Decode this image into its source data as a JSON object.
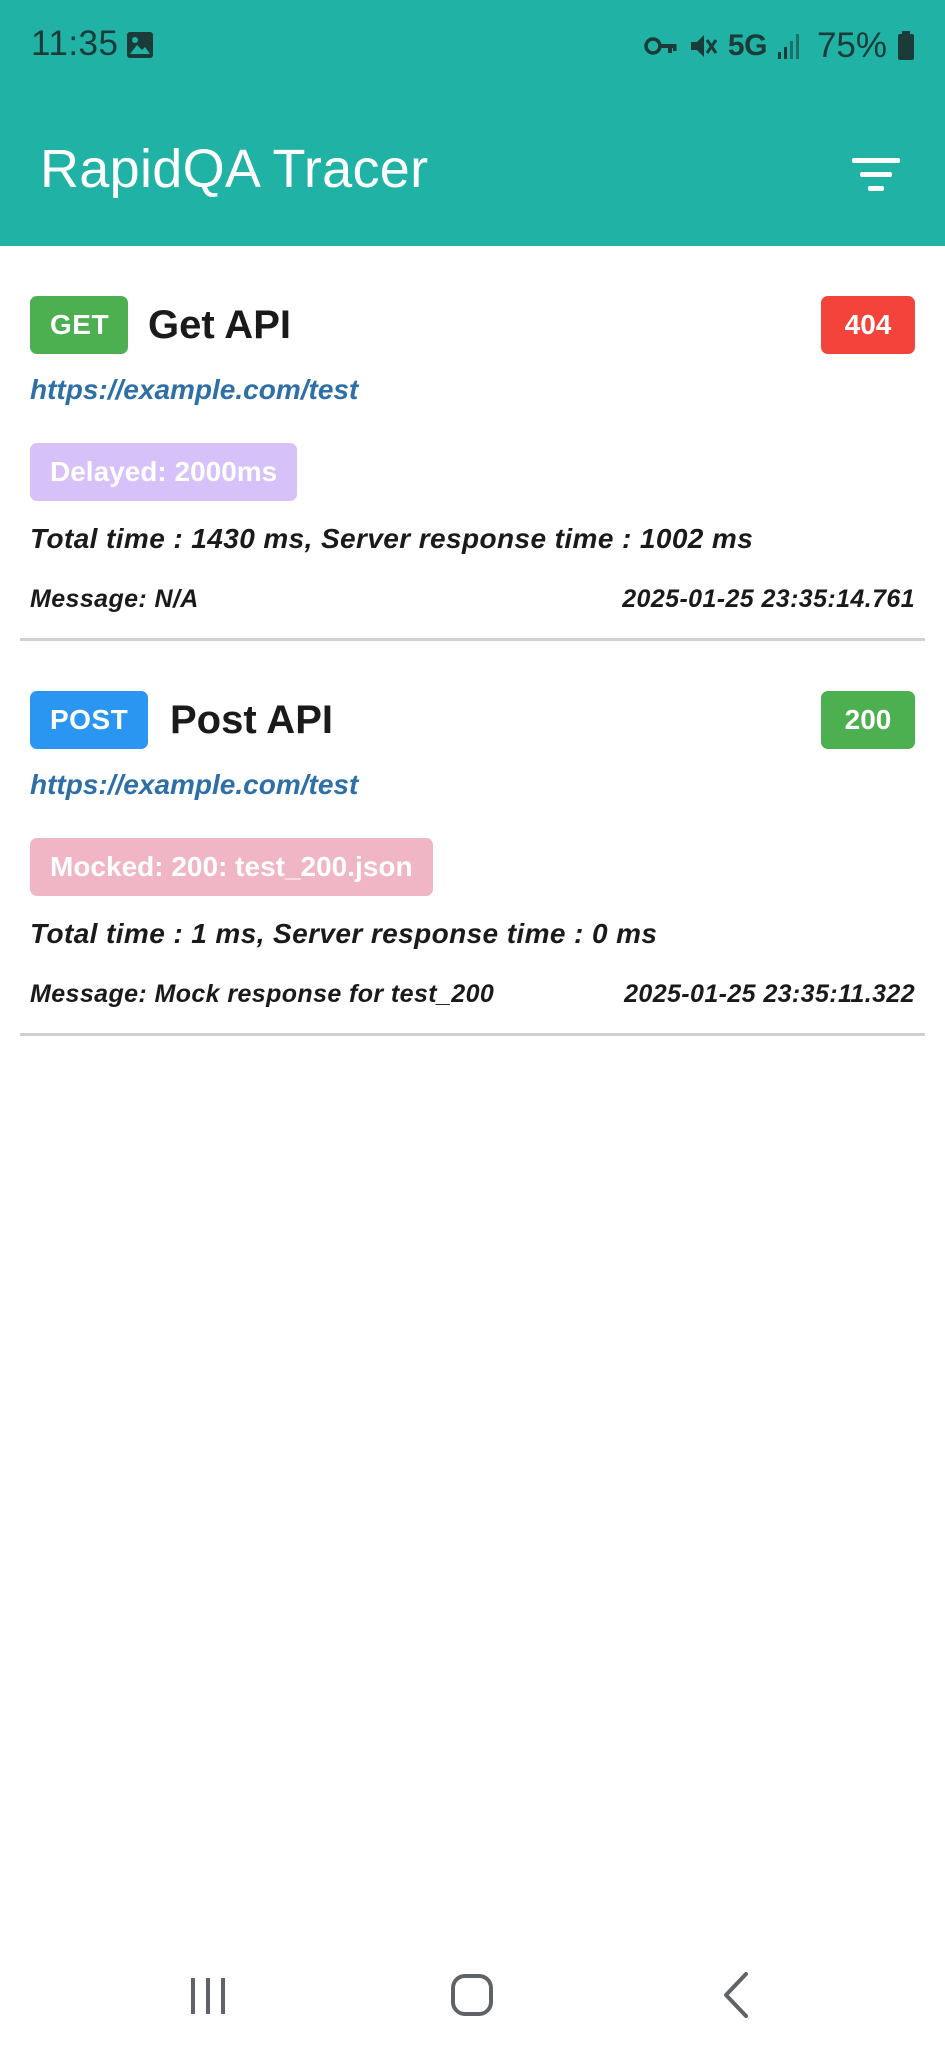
{
  "status_bar": {
    "time": "11:35",
    "network": "5G",
    "battery": "75%",
    "icons": [
      "gallery-icon",
      "vpn-key-icon",
      "mute-icon",
      "signal-icon",
      "battery-icon"
    ]
  },
  "header": {
    "title": "RapidQA Tracer",
    "filter_icon": "filter-icon"
  },
  "requests": [
    {
      "method": "GET",
      "name": "Get API",
      "status": "404",
      "url": "https://example.com/test",
      "tag": "Delayed: 2000ms",
      "timing": "Total time : 1430 ms, Server response time : 1002 ms",
      "message": "Message: N/A",
      "timestamp": "2025-01-25 23:35:14.761"
    },
    {
      "method": "POST",
      "name": "Post API",
      "status": "200",
      "url": "https://example.com/test",
      "tag": "Mocked: 200: test_200.json",
      "timing": "Total time : 1 ms, Server response time : 0 ms",
      "message": "Message: Mock response for test_200",
      "timestamp": "2025-01-25 23:35:11.322"
    }
  ],
  "colors": {
    "header": "#20b2a5",
    "get": "#4caf50",
    "post": "#2a96f2",
    "status_error": "#f4433b",
    "status_ok": "#4caf50",
    "delayed_tag": "#d6c1f9",
    "mocked_tag": "#f0b6c6",
    "url": "#2e6fa8"
  },
  "nav_bar": {
    "icons": [
      "recent-apps-icon",
      "home-icon",
      "back-icon"
    ]
  }
}
